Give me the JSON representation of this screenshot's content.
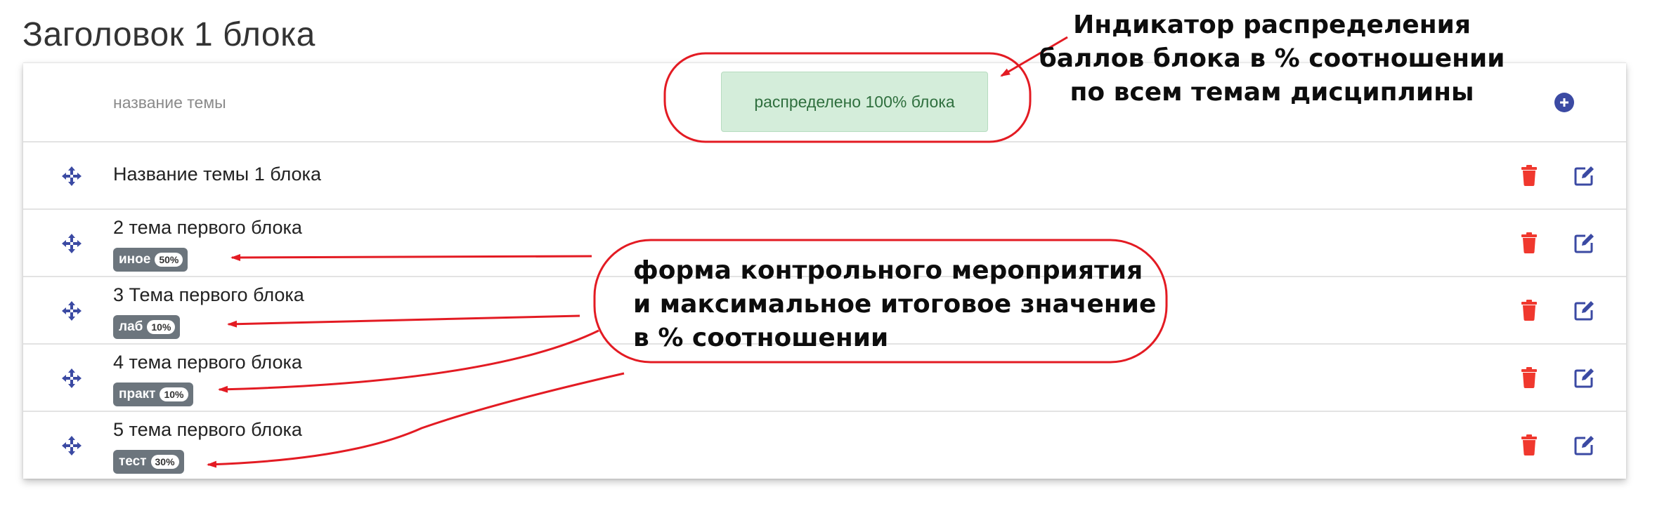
{
  "block": {
    "title": "Заголовок 1 блока"
  },
  "header": {
    "column_label": "название темы",
    "distribution_indicator": "распределено 100% блока"
  },
  "topics": [
    {
      "title": "Название темы 1 блока",
      "form": "",
      "percent": ""
    },
    {
      "title": "2 тема первого блока",
      "form": "иное",
      "percent": "50%"
    },
    {
      "title": "3 Тема первого блока",
      "form": "лаб",
      "percent": "10%"
    },
    {
      "title": "4 тема первого блока",
      "form": "практ",
      "percent": "10%"
    },
    {
      "title": "5 тема первого блока",
      "form": "тест",
      "percent": "30%"
    }
  ],
  "annotations": {
    "indicator_note": [
      "Индикатор распределения",
      "баллов блока в % соотношении",
      "по всем темам дисциплины"
    ],
    "form_note": [
      "форма контрольного мероприятия",
      "и максимальное итоговое значение",
      "в % соотношении"
    ]
  },
  "colors": {
    "accent_blue": "#3b4aa3",
    "delete_red": "#f0382e",
    "badge_gray": "#6c757d",
    "indicator_bg": "#d4edda",
    "annotation_red": "#e31b23"
  },
  "icons": {
    "move": "arrows-move-icon",
    "delete": "trash-icon",
    "edit": "edit-icon",
    "add": "plus-circle-icon"
  }
}
